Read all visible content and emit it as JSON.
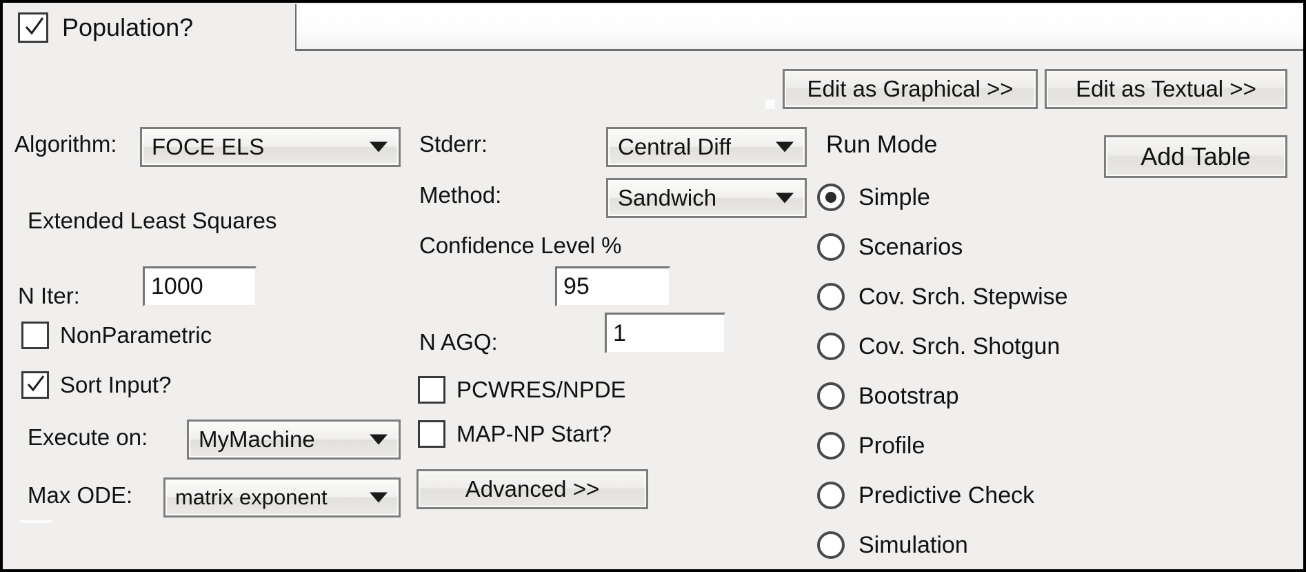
{
  "window": {
    "tab": {
      "label": "Population?",
      "checked": true,
      "checkbox_name": "population-checkbox"
    }
  },
  "toolbar": {
    "edit_graphical": "Edit as Graphical >>",
    "edit_textual": "Edit as Textual >>",
    "add_table": "Add Table"
  },
  "left_column": {
    "algorithm_label": "Algorithm:",
    "algorithm_value": "FOCE ELS",
    "algorithm_description": "Extended Least Squares",
    "n_iter_label": "N Iter:",
    "n_iter_value": "1000",
    "nonparametric_label": "NonParametric",
    "nonparametric_checked": false,
    "sort_input_label": "Sort Input?",
    "sort_input_checked": true,
    "execute_on_label": "Execute on:",
    "execute_on_value": "MyMachine",
    "max_ode_label": "Max ODE:",
    "max_ode_value": "matrix exponent"
  },
  "middle_column": {
    "stderr_label": "Stderr:",
    "stderr_value": "Central Diff",
    "method_label": "Method:",
    "method_value": "Sandwich",
    "confidence_label": "Confidence Level %",
    "confidence_value": "95",
    "n_agq_label": "N AGQ:",
    "n_agq_value": "1",
    "pcwres_label": "PCWRES/NPDE",
    "pcwres_checked": false,
    "mapnp_label": "MAP-NP Start?",
    "mapnp_checked": false,
    "advanced_label": "Advanced >>"
  },
  "run_mode": {
    "title": "Run Mode",
    "selected": "Simple",
    "options": [
      {
        "label": "Simple",
        "selected": true
      },
      {
        "label": "Scenarios",
        "selected": false
      },
      {
        "label": "Cov. Srch. Stepwise",
        "selected": false
      },
      {
        "label": "Cov. Srch. Shotgun",
        "selected": false
      },
      {
        "label": "Bootstrap",
        "selected": false
      },
      {
        "label": "Profile",
        "selected": false
      },
      {
        "label": "Predictive Check",
        "selected": false
      },
      {
        "label": "Simulation",
        "selected": false
      }
    ]
  },
  "colors": {
    "window_background": "#f0efee",
    "border": "#000000",
    "control_border": "#7d7d7d",
    "text": "#111111",
    "field_background": "#ffffff"
  }
}
